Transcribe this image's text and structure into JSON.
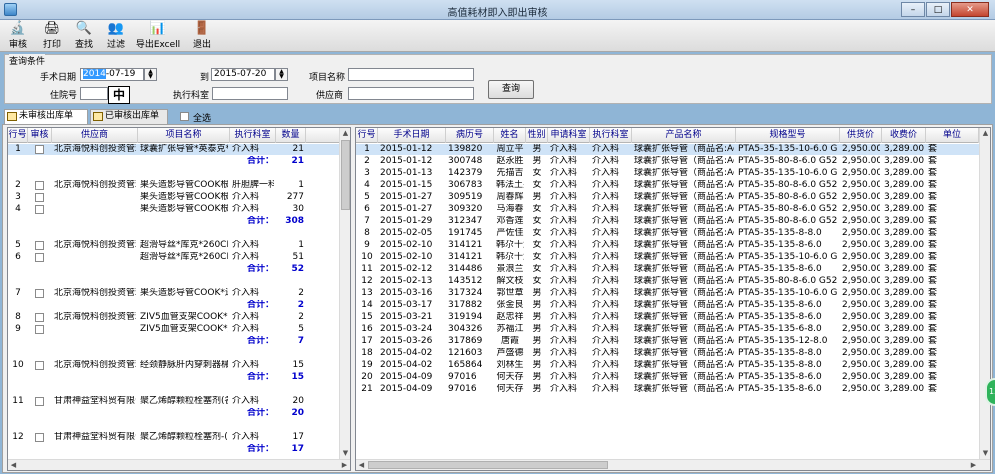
{
  "window": {
    "title": "高值耗材即入即出审核",
    "min": "–",
    "max": "□",
    "close": "✕"
  },
  "toolbar": [
    {
      "label": "审核",
      "icon": "audit-icon",
      "glyph": "🔬"
    },
    {
      "label": "打印",
      "icon": "print-icon",
      "glyph": "🖨"
    },
    {
      "label": "查找",
      "icon": "search-icon",
      "glyph": "🔍"
    },
    {
      "label": "过滤",
      "icon": "filter-icon",
      "glyph": "👥"
    },
    {
      "label": "导出Excell",
      "icon": "excel-icon",
      "glyph": "📊"
    },
    {
      "label": "退出",
      "icon": "exit-icon",
      "glyph": "🚪"
    }
  ],
  "query": {
    "legend": "查询条件",
    "date_label": "手术日期",
    "date_from_year": "2014",
    "date_from_rest": "-07-19",
    "to_label": "到",
    "date_to": "2015-07-20",
    "product_label": "项目名称",
    "product_value": "",
    "inpatient_label": "住院号",
    "inpatient_value": "",
    "ime_indicator": "中",
    "dept_label": "执行科室",
    "dept_value": "",
    "supplier_label": "供应商",
    "supplier_value": "",
    "query_button": "查询",
    "spin_up": "▲",
    "spin_down": "▼"
  },
  "tabs": {
    "pending": "未审核出库单",
    "audited": "已审核出库单",
    "select_all": "全选"
  },
  "left": {
    "headers": [
      "行号",
      "审核",
      "供应商",
      "项目名称",
      "执行科室",
      "数量"
    ],
    "rows": [
      {
        "n": "1",
        "chk": true,
        "sup": "北京海悦科创投资管理",
        "item": "球囊扩张导管*英泰克*根",
        "dept": "介入科",
        "qty": "21",
        "sel": true
      },
      {
        "n": "",
        "chk": false,
        "sup": "",
        "item": "",
        "dept": "合计：",
        "qty": "21",
        "total": true
      },
      {
        "n": "",
        "chk": false,
        "sup": "",
        "item": "",
        "dept": "",
        "qty": "",
        "blank": true
      },
      {
        "n": "2",
        "chk": true,
        "sup": "北京海悦科创投资管理",
        "item": "果头造影导管COOK根",
        "dept": "肝胆脾一科",
        "qty": "1"
      },
      {
        "n": "3",
        "chk": true,
        "sup": "",
        "item": "果头造影导管COOK根",
        "dept": "介入科",
        "qty": "277"
      },
      {
        "n": "4",
        "chk": true,
        "sup": "",
        "item": "果头造影导管COOK根",
        "dept": "介入科",
        "qty": "30"
      },
      {
        "n": "",
        "chk": false,
        "sup": "",
        "item": "",
        "dept": "合计：",
        "qty": "308",
        "total": true
      },
      {
        "n": "",
        "chk": false,
        "sup": "",
        "item": "",
        "dept": "",
        "qty": "",
        "blank": true
      },
      {
        "n": "5",
        "chk": true,
        "sup": "北京海悦科创投资管理",
        "item": "超滑导丝*库克*260CM根",
        "dept": "介入科",
        "qty": "1"
      },
      {
        "n": "6",
        "chk": true,
        "sup": "",
        "item": "超滑导丝*库克*260CM根",
        "dept": "介入科",
        "qty": "51"
      },
      {
        "n": "",
        "chk": false,
        "sup": "",
        "item": "",
        "dept": "合计：",
        "qty": "52",
        "total": true
      },
      {
        "n": "",
        "chk": false,
        "sup": "",
        "item": "",
        "dept": "",
        "qty": "",
        "blank": true
      },
      {
        "n": "7",
        "chk": true,
        "sup": "北京海悦科创投资管理",
        "item": "果头造影导管COOK*进口*根",
        "dept": "介入科",
        "qty": "2"
      },
      {
        "n": "",
        "chk": false,
        "sup": "",
        "item": "",
        "dept": "合计：",
        "qty": "2",
        "total": true
      },
      {
        "n": "8",
        "chk": true,
        "sup": "北京海悦科创投资管理",
        "item": "ZIV5血管支架COOK*进口*套",
        "dept": "介入科",
        "qty": "2"
      },
      {
        "n": "9",
        "chk": true,
        "sup": "",
        "item": "ZIV5血管支架COOK*进口*套",
        "dept": "介入科",
        "qty": "5"
      },
      {
        "n": "",
        "chk": false,
        "sup": "",
        "item": "",
        "dept": "合计：",
        "qty": "7",
        "total": true
      },
      {
        "n": "",
        "chk": false,
        "sup": "",
        "item": "",
        "dept": "",
        "qty": "",
        "blank": true
      },
      {
        "n": "10",
        "chk": true,
        "sup": "北京海悦科创投资管理",
        "item": "经颈静脉肝内穿刺器械RUPS",
        "dept": "介入科",
        "qty": "15"
      },
      {
        "n": "",
        "chk": false,
        "sup": "",
        "item": "",
        "dept": "合计：",
        "qty": "15",
        "total": true
      },
      {
        "n": "",
        "chk": false,
        "sup": "",
        "item": "",
        "dept": "",
        "qty": "",
        "blank": true
      },
      {
        "n": "11",
        "chk": true,
        "sup": "甘肃神益堂科贸有限公司",
        "item": "聚乙烯醇颗粒栓塞剂(各规格)",
        "dept": "介入科",
        "qty": "20"
      },
      {
        "n": "",
        "chk": false,
        "sup": "",
        "item": "",
        "dept": "合计：",
        "qty": "20",
        "total": true
      },
      {
        "n": "",
        "chk": false,
        "sup": "",
        "item": "",
        "dept": "",
        "qty": "",
        "blank": true
      },
      {
        "n": "12",
        "chk": true,
        "sup": "甘肃神益堂科贸有限公司",
        "item": "聚乙烯醇颗粒栓塞剂-(各规格)",
        "dept": "介入科",
        "qty": "17"
      },
      {
        "n": "",
        "chk": false,
        "sup": "",
        "item": "",
        "dept": "合计：",
        "qty": "17",
        "total": true
      }
    ]
  },
  "right": {
    "headers": [
      "行号",
      "手术日期",
      "病历号",
      "姓名",
      "性别",
      "申请科室",
      "执行科室",
      "产品名称",
      "规格型号",
      "供货价",
      "收费价",
      "单位"
    ],
    "rows": [
      [
        "1",
        "2015-01-12",
        "139820",
        "周立平",
        "男",
        "介入科",
        "介入科",
        "球囊扩张导管（商品名:Adv",
        "PTA5-35-135-10-6.0 G522",
        "2,950.00",
        "3,289.00",
        "套"
      ],
      [
        "2",
        "2015-01-12",
        "300748",
        "赵永胜",
        "男",
        "介入科",
        "介入科",
        "球囊扩张导管（商品名:Adv",
        "PTA5-35-80-8-6.0 G52360",
        "2,950.00",
        "3,289.00",
        "套"
      ],
      [
        "3",
        "2015-01-13",
        "142379",
        "先描吉",
        "女",
        "介入科",
        "介入科",
        "球囊扩张导管（商品名:Adv",
        "PTA5-35-135-10-6.0 G522",
        "2,950.00",
        "3,289.00",
        "套"
      ],
      [
        "4",
        "2015-01-15",
        "306783",
        "韩法土买",
        "女",
        "介入科",
        "介入科",
        "球囊扩张导管（商品名:Adv",
        "PTA5-35-80-8-6.0 G52360",
        "2,950.00",
        "3,289.00",
        "套"
      ],
      [
        "5",
        "2015-01-27",
        "309519",
        "周春辉",
        "男",
        "介入科",
        "介入科",
        "球囊扩张导管（商品名:Adv",
        "PTA5-35-80-8-6.0 G52360",
        "2,950.00",
        "3,289.00",
        "套"
      ],
      [
        "6",
        "2015-01-27",
        "309320",
        "马海春",
        "女",
        "介入科",
        "介入科",
        "球囊扩张导管（商品名:Adv",
        "PTA5-35-80-8-6.0 G52360",
        "2,950.00",
        "3,289.00",
        "套"
      ],
      [
        "7",
        "2015-01-29",
        "312347",
        "邓香莲",
        "女",
        "介入科",
        "介入科",
        "球囊扩张导管（商品名:Adv",
        "PTA5-35-80-8-6.0 G52360",
        "2,950.00",
        "3,289.00",
        "套"
      ],
      [
        "8",
        "2015-02-05",
        "191745",
        "严佐佳",
        "女",
        "介入科",
        "介入科",
        "球囊扩张导管（商品名:Adv",
        "PTA5-35-135-8-8.0",
        "2,950.00",
        "3,289.00",
        "套"
      ],
      [
        "9",
        "2015-02-10",
        "314121",
        "韩尕十六",
        "女",
        "介入科",
        "介入科",
        "球囊扩张导管（商品名:Adv",
        "PTA5-35-135-8-6.0",
        "2,950.00",
        "3,289.00",
        "套"
      ],
      [
        "10",
        "2015-02-10",
        "314121",
        "韩尕十六",
        "女",
        "介入科",
        "介入科",
        "球囊扩张导管（商品名:Adv",
        "PTA5-35-135-10-6.0 G522",
        "2,950.00",
        "3,289.00",
        "套"
      ],
      [
        "11",
        "2015-02-12",
        "314486",
        "景浪兰",
        "女",
        "介入科",
        "介入科",
        "球囊扩张导管（商品名:Adv",
        "PTA5-35-135-8-6.0",
        "2,950.00",
        "3,289.00",
        "套"
      ],
      [
        "12",
        "2015-02-13",
        "143512",
        "解文枝",
        "女",
        "介入科",
        "介入科",
        "球囊扩张导管（商品名:Adv",
        "PTA5-35-80-8-6.0 G52360",
        "2,950.00",
        "3,289.00",
        "套"
      ],
      [
        "13",
        "2015-03-16",
        "317324",
        "郭世章",
        "男",
        "介入科",
        "介入科",
        "球囊扩张导管（商品名:Adv",
        "PTA5-35-135-10-6.0 G522",
        "2,950.00",
        "3,289.00",
        "套"
      ],
      [
        "14",
        "2015-03-17",
        "317882",
        "张金良",
        "男",
        "介入科",
        "介入科",
        "球囊扩张导管（商品名:Adv",
        "PTA5-35-135-8-6.0",
        "2,950.00",
        "3,289.00",
        "套"
      ],
      [
        "15",
        "2015-03-21",
        "319194",
        "赵忠祥",
        "男",
        "介入科",
        "介入科",
        "球囊扩张导管（商品名:Adv",
        "PTA5-35-135-8-6.0",
        "2,950.00",
        "3,289.00",
        "套"
      ],
      [
        "16",
        "2015-03-24",
        "304326",
        "苏福江",
        "男",
        "介入科",
        "介入科",
        "球囊扩张导管（商品名:Adv",
        "PTA5-35-135-6-8.0",
        "2,950.00",
        "3,289.00",
        "套"
      ],
      [
        "17",
        "2015-03-26",
        "317869",
        "唐霞",
        "男",
        "介入科",
        "介入科",
        "球囊扩张导管（商品名:Adv",
        "PTA5-35-135-12-8.0",
        "2,950.00",
        "3,289.00",
        "套"
      ],
      [
        "18",
        "2015-04-02",
        "121603",
        "芦盛德",
        "男",
        "介入科",
        "介入科",
        "球囊扩张导管（商品名:Adv",
        "PTA5-35-135-8-8.0",
        "2,950.00",
        "3,289.00",
        "套"
      ],
      [
        "19",
        "2015-04-02",
        "165864",
        "刘林生",
        "男",
        "介入科",
        "介入科",
        "球囊扩张导管（商品名:Adv",
        "PTA5-35-135-8-8.0",
        "2,950.00",
        "3,289.00",
        "套"
      ],
      [
        "20",
        "2015-04-09",
        "97016",
        "何天存",
        "男",
        "介入科",
        "介入科",
        "球囊扩张导管（商品名:Adv",
        "PTA5-35-135-8-6.0",
        "2,950.00",
        "3,289.00",
        "套"
      ],
      [
        "21",
        "2015-04-09",
        "97016",
        "何天存",
        "男",
        "介入科",
        "介入科",
        "球囊扩张导管（商品名:Adv",
        "PTA5-35-135-8-6.0",
        "2,950.00",
        "3,289.00",
        "套"
      ]
    ]
  },
  "scroll": {
    "up": "▲",
    "down": "▼",
    "left": "◀",
    "right": "▶"
  },
  "float_button": "13",
  "colors": {
    "selected_row": "#cfe3f7",
    "header_text": "#00008b",
    "total_text": "#0000cc",
    "title_bar": "#b4cbe4"
  }
}
